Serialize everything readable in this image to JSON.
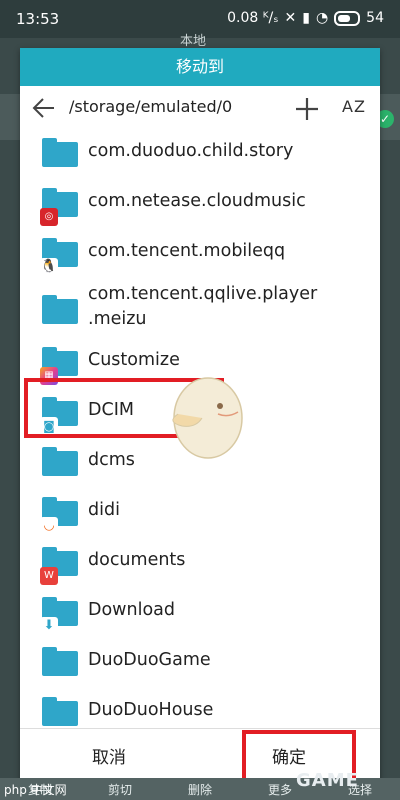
{
  "status_bar": {
    "time": "13:53",
    "speed": "0.08 ᴷ/ₛ",
    "battery": "54"
  },
  "background_app": {
    "title": "本地"
  },
  "dialog": {
    "title": "移动到",
    "path": "/storage/emulated/0",
    "sort_label": "AZ",
    "items": [
      {
        "label": "com.duoduo.child.story"
      },
      {
        "label": "com.netease.cloudmusic"
      },
      {
        "label": "com.tencent.mobileqq"
      },
      {
        "label": "com.tencent.qqlive.player",
        "label2": ".meizu"
      },
      {
        "label": "Customize"
      },
      {
        "label": "DCIM"
      },
      {
        "label": "dcms"
      },
      {
        "label": "didi"
      },
      {
        "label": "documents"
      },
      {
        "label": "Download"
      },
      {
        "label": "DuoDuoGame"
      },
      {
        "label": "DuoDuoHouse"
      }
    ],
    "cancel_label": "取消",
    "ok_label": "确定"
  },
  "bottom_toolbar": [
    "复制",
    "剪切",
    "删除",
    "更多",
    "选择"
  ],
  "colors": {
    "folder": "#2fa6c9",
    "header": "#20aabf",
    "highlight": "#e21d24"
  },
  "watermarks": {
    "left": "php 中文网",
    "right": "GAME"
  }
}
